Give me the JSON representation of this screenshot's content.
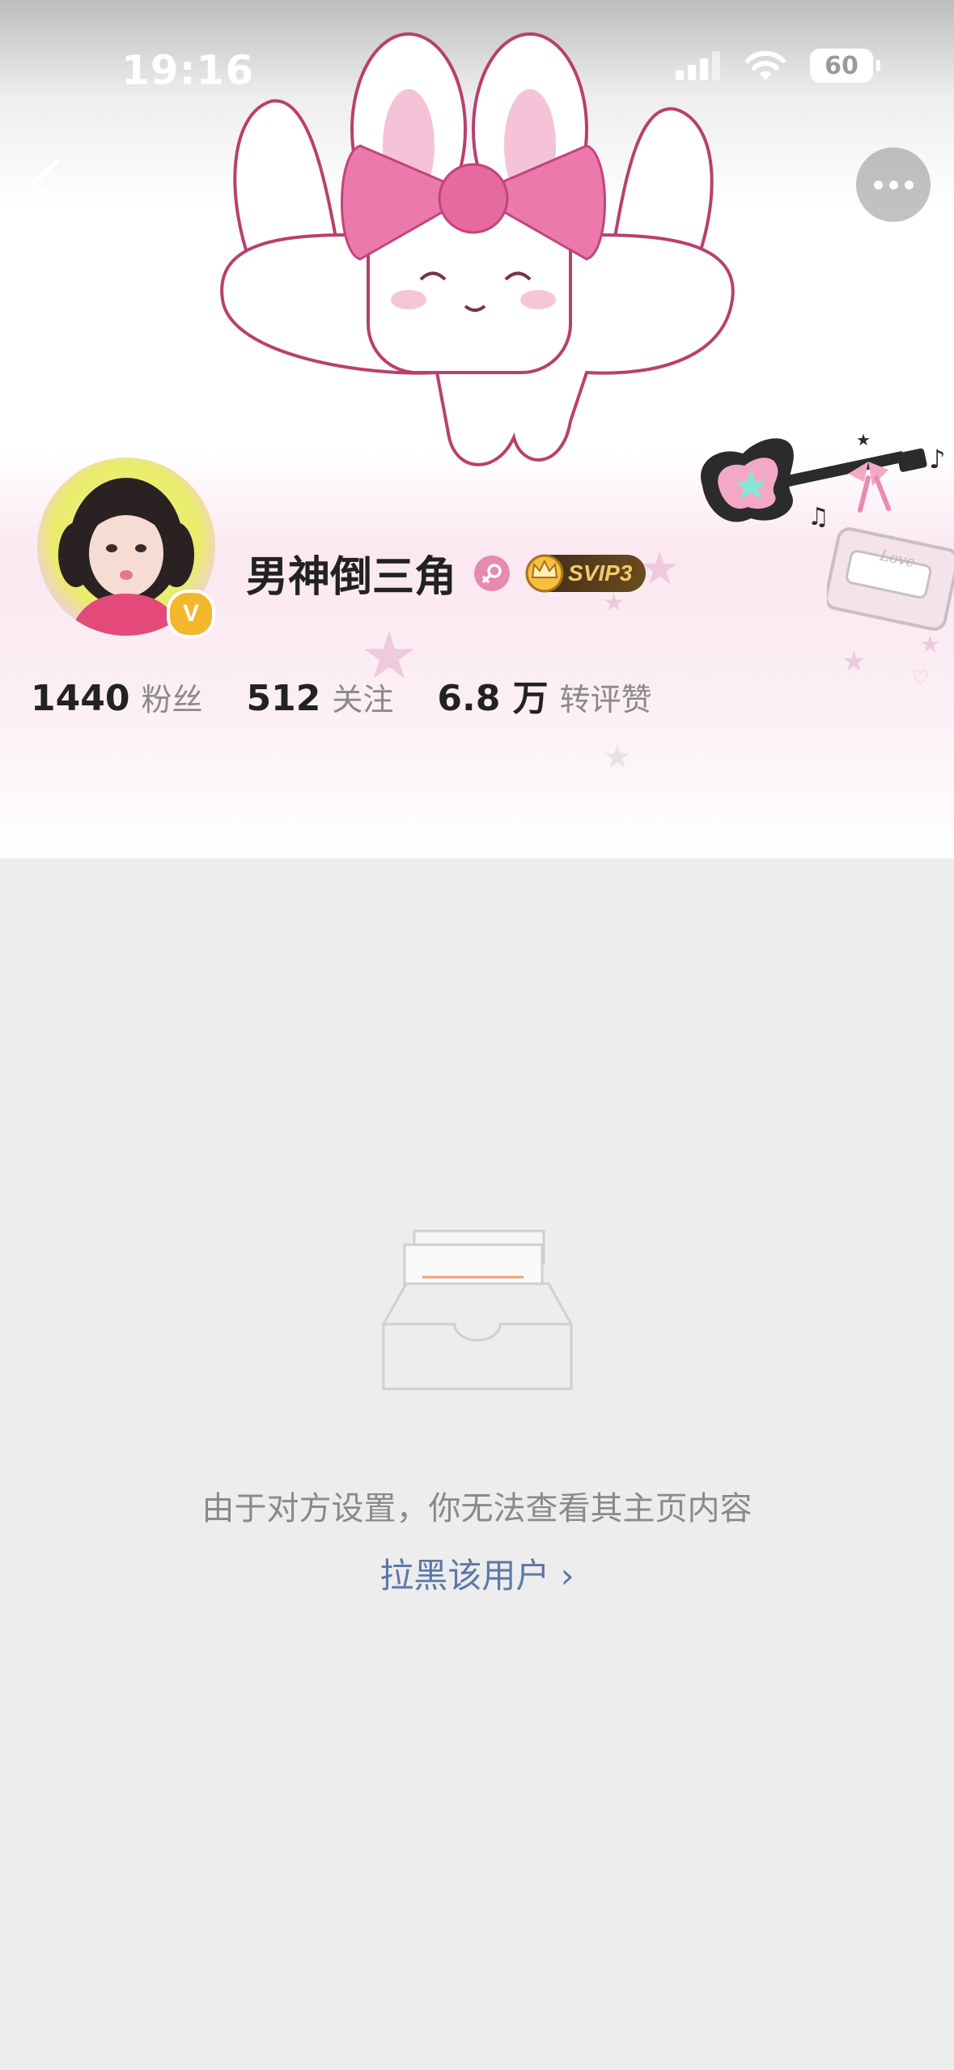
{
  "status_bar": {
    "time": "19:16",
    "battery_level": "60"
  },
  "nav": {
    "back_icon": "chevron-left-icon",
    "more_icon": "more-dots-icon"
  },
  "profile": {
    "username": "男神倒三角",
    "gender": "female",
    "vip_badge": "SVIP3",
    "verified_icon": "V"
  },
  "stats": [
    {
      "value": "1440",
      "label": "粉丝"
    },
    {
      "value": "512",
      "label": "关注"
    },
    {
      "value": "6.8 万",
      "label": "转评赞"
    }
  ],
  "privacy": {
    "notice": "由于对方设置，你无法查看其主页内容",
    "block_link": "拉黑该用户 ›"
  },
  "colors": {
    "accent_pink": "#e68ab0",
    "link_blue": "#5b78a8",
    "vip_gold": "#f5c86a",
    "page_gray": "#ededed"
  }
}
